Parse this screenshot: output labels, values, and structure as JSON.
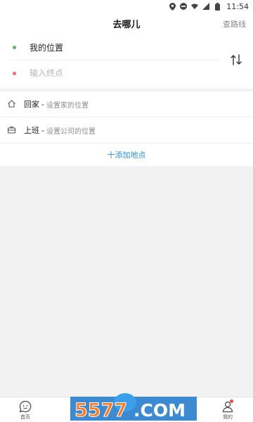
{
  "status_bar": {
    "time": "11:54",
    "icons": [
      "location-icon",
      "dnd-icon",
      "wifi-icon",
      "signal-icon",
      "battery-icon"
    ]
  },
  "header": {
    "title": "去哪儿",
    "action": "查路线"
  },
  "route": {
    "start_label": "我的位置",
    "end_placeholder": "输入终点",
    "start_color": "#5cb85c",
    "end_color": "#f26b6b"
  },
  "places": [
    {
      "name": "回家",
      "separator": "-",
      "hint": "设置家的位置",
      "icon": "home-icon"
    },
    {
      "name": "上班",
      "separator": "-",
      "hint": "设置公司的位置",
      "icon": "briefcase-icon"
    }
  ],
  "add_place": "十添加地点",
  "bottom_nav": [
    {
      "label": "首页",
      "icon": "chat-face-icon",
      "active": false
    },
    {
      "label": "",
      "icon": "nav-icon-2",
      "active": false
    },
    {
      "label": "",
      "icon": "nav-icon-3",
      "active": false
    },
    {
      "label": "",
      "icon": "nav-icon-4",
      "active": false
    },
    {
      "label": "我的",
      "icon": "person-icon",
      "active": false,
      "badge": true
    }
  ],
  "watermark": {
    "text": "5577.COM"
  },
  "colors": {
    "accent": "#2a8de5",
    "background": "#f2f2f2"
  }
}
